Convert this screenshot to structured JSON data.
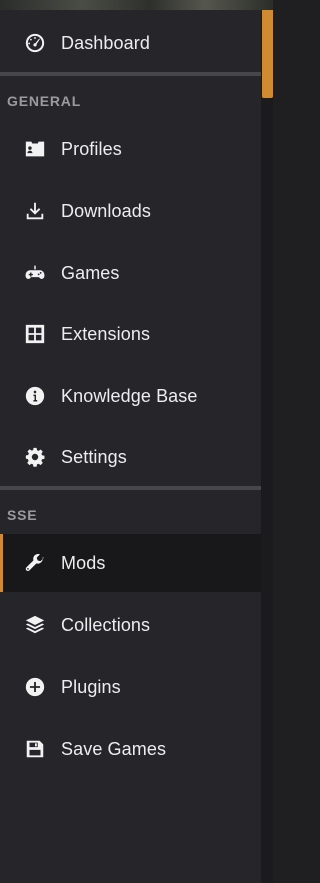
{
  "sidebar": {
    "dashboard": {
      "label": "Dashboard",
      "icon": "dashboard-gauge-icon"
    },
    "sections": [
      {
        "header": "GENERAL",
        "items": [
          {
            "label": "Profiles",
            "icon": "profile-card-icon"
          },
          {
            "label": "Downloads",
            "icon": "download-icon"
          },
          {
            "label": "Games",
            "icon": "gamepad-icon"
          },
          {
            "label": "Extensions",
            "icon": "extensions-icon"
          },
          {
            "label": "Knowledge Base",
            "icon": "info-icon"
          },
          {
            "label": "Settings",
            "icon": "gear-icon"
          }
        ]
      },
      {
        "header": "SSE",
        "items": [
          {
            "label": "Mods",
            "icon": "wrench-icon",
            "active": true
          },
          {
            "label": "Collections",
            "icon": "layers-icon"
          },
          {
            "label": "Plugins",
            "icon": "plus-circle-icon"
          },
          {
            "label": "Save Games",
            "icon": "floppy-disk-icon"
          }
        ]
      }
    ]
  },
  "colors": {
    "accent": "#d08a32",
    "sidebar_bg": "#26262a",
    "active_bg": "#18181b",
    "header_text": "#9a9aa0"
  }
}
